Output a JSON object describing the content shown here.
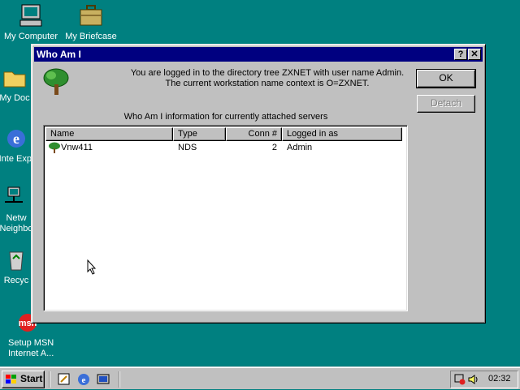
{
  "desktop": {
    "icons": [
      {
        "label": "My Computer"
      },
      {
        "label": "My Briefcase"
      },
      {
        "label": "My Doc"
      },
      {
        "label": "Inte Expl"
      },
      {
        "label": "Netw Neighbo"
      },
      {
        "label": "Recyc"
      },
      {
        "label": "Setup MSN Internet A..."
      }
    ]
  },
  "dialog": {
    "title": "Who Am I",
    "help_glyph": "?",
    "close_glyph": "✕",
    "message_line1": "You are logged in to the directory tree ZXNET with user name Admin.",
    "message_line2": "The current workstation name context is O=ZXNET.",
    "ok_label": "OK",
    "detach_label": "Detach",
    "list_caption": "Who Am I information for currently attached servers",
    "columns": [
      "Name",
      "Type",
      "Conn #",
      "Logged in as"
    ],
    "rows": [
      {
        "name": "Vnw411",
        "type": "NDS",
        "conn": "2",
        "logged_in_as": "Admin"
      }
    ]
  },
  "taskbar": {
    "start_label": "Start",
    "clock": "02:32"
  }
}
